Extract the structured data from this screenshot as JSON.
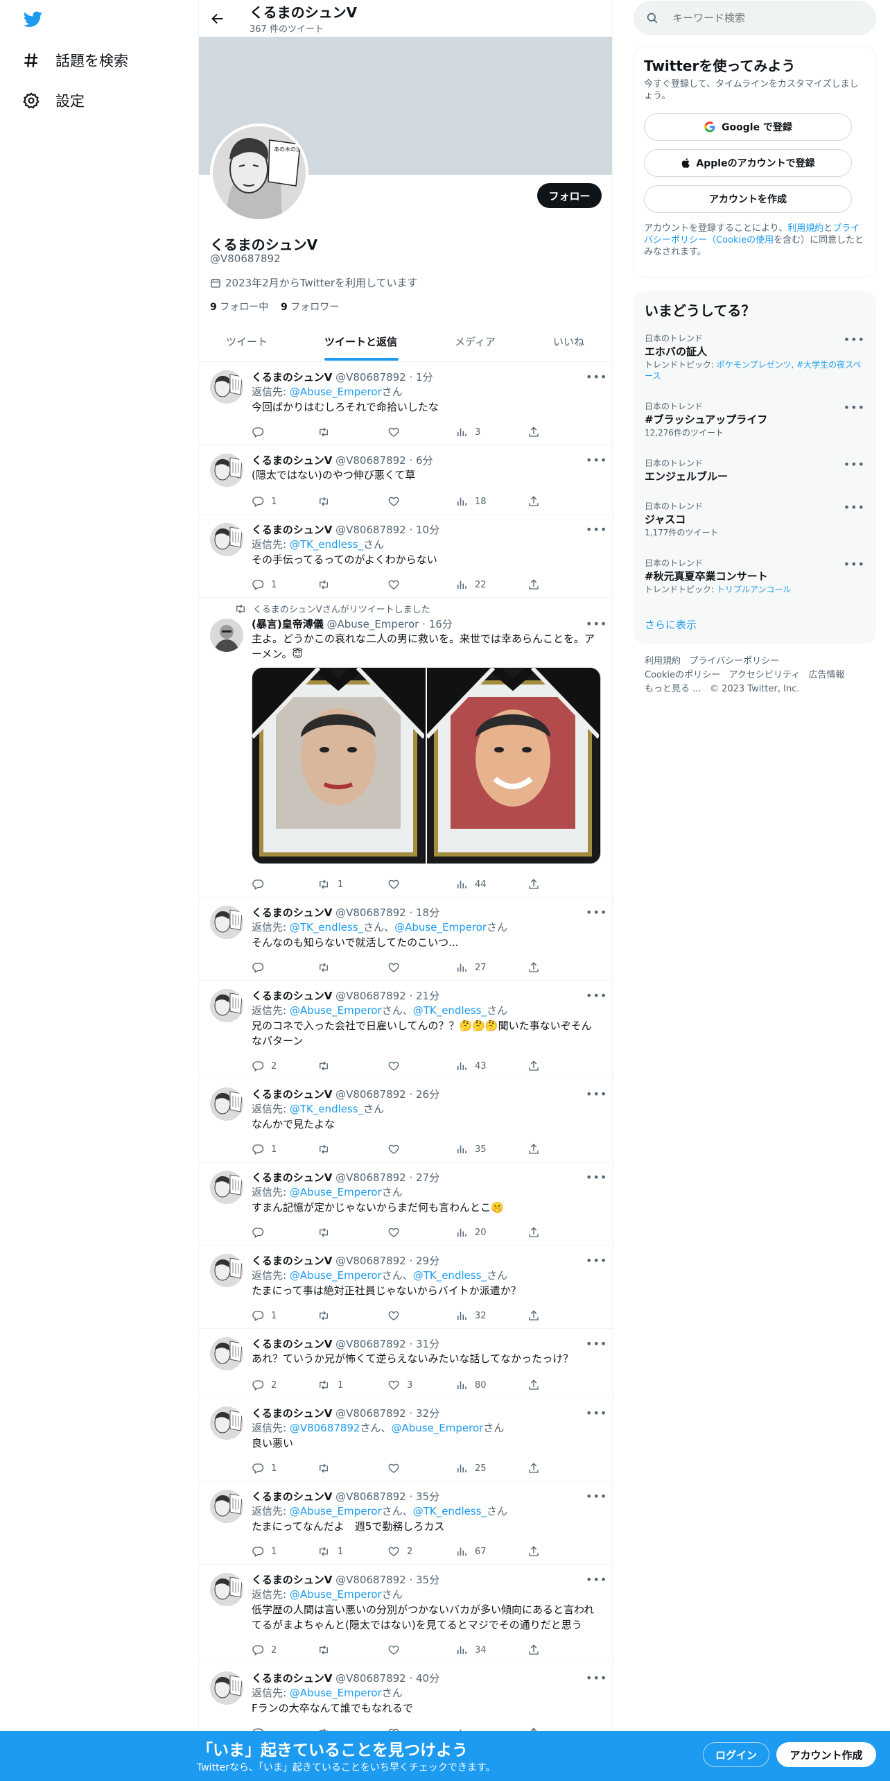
{
  "nav": {
    "explore": "話題を検索",
    "settings": "設定"
  },
  "header": {
    "name": "くるまのシュンV",
    "count": "367 件のツイート"
  },
  "profile": {
    "name": "くるまのシュンV",
    "handle": "@V80687892",
    "joined": "2023年2月からTwitterを利用しています",
    "following_num": "9",
    "following_label": "フォロー中",
    "followers_num": "9",
    "followers_label": "フォロワー",
    "follow_button": "フォロー",
    "avatar_text": "あの木の渋い実がる…"
  },
  "tabs": [
    "ツイート",
    "ツイートと返信",
    "メディア",
    "いいね"
  ],
  "tweets": [
    {
      "name": "くるまのシュンV",
      "handle": "@V80687892",
      "time": "1分",
      "reply_prefix": "返信先: ",
      "reply_to": "@Abuse_Emperor",
      "reply_suffix": "さん",
      "text": "今回ばかりはむしろそれで命拾いしたな",
      "replies": "",
      "retweets": "",
      "likes": "",
      "views": "3"
    },
    {
      "name": "くるまのシュンV",
      "handle": "@V80687892",
      "time": "6分",
      "text": "(隠太ではない)のやつ伸び悪くて草",
      "replies": "1",
      "retweets": "",
      "likes": "",
      "views": "18"
    },
    {
      "name": "くるまのシュンV",
      "handle": "@V80687892",
      "time": "10分",
      "reply_prefix": "返信先: ",
      "reply_to": "@TK_endless_",
      "reply_suffix": "さん",
      "text": "その手伝ってるってのがよくわからない",
      "replies": "1",
      "retweets": "",
      "likes": "",
      "views": "22"
    },
    {
      "retweet_label": "くるまのシュンVさんがリツイートしました",
      "name": "(暴言)皇帝溥儀",
      "handle": "@Abuse_Emperor",
      "time": "16分",
      "text": "主よ。どうかこの哀れな二人の男に救いを。来世では幸あらんことを。アーメン。😇",
      "replies": "",
      "retweets": "1",
      "likes": "",
      "views": "44"
    },
    {
      "name": "くるまのシュンV",
      "handle": "@V80687892",
      "time": "18分",
      "reply_prefix": "返信先: ",
      "reply_to": "@TK_endless_",
      "reply_suffix": "さん、",
      "reply_to2": "@Abuse_Emperor",
      "reply_suffix2": "さん",
      "text": "そんなのも知らないで就活してたのこいつ...",
      "replies": "",
      "retweets": "",
      "likes": "",
      "views": "27"
    },
    {
      "name": "くるまのシュンV",
      "handle": "@V80687892",
      "time": "21分",
      "reply_prefix": "返信先: ",
      "reply_to": "@Abuse_Emperor",
      "reply_suffix": "さん、",
      "reply_to2": "@TK_endless_",
      "reply_suffix2": "さん",
      "text": "兄のコネで入った会社で日雇いしてんの？？🤔🤔🤔聞いた事ないぞそんなパターン",
      "replies": "2",
      "retweets": "",
      "likes": "",
      "views": "43"
    },
    {
      "name": "くるまのシュンV",
      "handle": "@V80687892",
      "time": "26分",
      "reply_prefix": "返信先: ",
      "reply_to": "@TK_endless_",
      "reply_suffix": "さん",
      "text": "なんかで見たよな",
      "replies": "1",
      "retweets": "",
      "likes": "",
      "views": "35"
    },
    {
      "name": "くるまのシュンV",
      "handle": "@V80687892",
      "time": "27分",
      "reply_prefix": "返信先: ",
      "reply_to": "@Abuse_Emperor",
      "reply_suffix": "さん",
      "text": "すまん記憶が定かじゃないからまだ何も言わんとこ🤫",
      "replies": "",
      "retweets": "",
      "likes": "",
      "views": "20"
    },
    {
      "name": "くるまのシュンV",
      "handle": "@V80687892",
      "time": "29分",
      "reply_prefix": "返信先: ",
      "reply_to": "@Abuse_Emperor",
      "reply_suffix": "さん、",
      "reply_to2": "@TK_endless_",
      "reply_suffix2": "さん",
      "text": "たまにって事は絶対正社員じゃないからバイトか派遣か？",
      "replies": "1",
      "retweets": "",
      "likes": "",
      "views": "32"
    },
    {
      "name": "くるまのシュンV",
      "handle": "@V80687892",
      "time": "31分",
      "text": "あれ？ていうか兄が怖くて逆らえないみたいな話してなかったっけ？",
      "replies": "2",
      "retweets": "1",
      "likes": "3",
      "views": "80"
    },
    {
      "name": "くるまのシュンV",
      "handle": "@V80687892",
      "time": "32分",
      "reply_prefix": "返信先: ",
      "reply_to": "@V80687892",
      "reply_suffix": "さん、",
      "reply_to2": "@Abuse_Emperor",
      "reply_suffix2": "さん",
      "text": "良い悪い",
      "replies": "1",
      "retweets": "",
      "likes": "",
      "views": "25"
    },
    {
      "name": "くるまのシュンV",
      "handle": "@V80687892",
      "time": "35分",
      "reply_prefix": "返信先: ",
      "reply_to": "@Abuse_Emperor",
      "reply_suffix": "さん、",
      "reply_to2": "@TK_endless_",
      "reply_suffix2": "さん",
      "text": "たまにってなんだよ　週5で勤務しろカス",
      "replies": "1",
      "retweets": "1",
      "likes": "2",
      "views": "67"
    },
    {
      "name": "くるまのシュンV",
      "handle": "@V80687892",
      "time": "35分",
      "reply_prefix": "返信先: ",
      "reply_to": "@Abuse_Emperor",
      "reply_suffix": "さん",
      "text": "低学歴の人間は言い悪いの分別がつかないバカが多い傾向にあると言われてるがまよちゃんと(隠太ではない)を見てるとマジでその通りだと思う",
      "replies": "2",
      "retweets": "",
      "likes": "",
      "views": "34"
    },
    {
      "name": "くるまのシュンV",
      "handle": "@V80687892",
      "time": "40分",
      "reply_prefix": "返信先: ",
      "reply_to": "@Abuse_Emperor",
      "reply_suffix": "さん",
      "text": "Fランの大卒なんて誰でもなれるで",
      "replies": "",
      "retweets": "",
      "likes": "",
      "views": ""
    }
  ],
  "right": {
    "search_placeholder": "キーワード検索",
    "signup_title": "Twitterを使ってみよう",
    "signup_sub": "今すぐ登録して、タイムラインをカスタマイズしましょう。",
    "google": "Google で登録",
    "apple": "Appleのアカウントで登録",
    "create": "アカウントを作成",
    "terms_1": "アカウントを登録することにより、",
    "terms_link1": "利用規約",
    "terms_2": "と",
    "terms_link2": "プライバシーポリシー（Cookieの使用",
    "terms_3": "を含む）に同意したとみなされます。",
    "trends_title": "いまどうしてる？",
    "trends": [
      {
        "category": "日本のトレンド",
        "title": "エホバの証人",
        "sub_prefix": "トレンドトピック: ",
        "sub_links": "ポケモンプレゼンツ, #大学生の夜スペース"
      },
      {
        "category": "日本のトレンド",
        "title": "#ブラッシュアップライフ",
        "sub": "12,276件のツイート"
      },
      {
        "category": "日本のトレンド",
        "title": "エンジェルブルー"
      },
      {
        "category": "日本のトレンド",
        "title": "ジャスコ",
        "sub": "1,177件のツイート"
      },
      {
        "category": "日本のトレンド",
        "title": "#秋元真夏卒業コンサート",
        "sub_prefix": "トレンドトピック: ",
        "sub_links": "トリプルアンコール"
      }
    ],
    "show_more": "さらに表示",
    "footer": [
      "利用規約",
      "プライバシーポリシー",
      "Cookieのポリシー",
      "アクセシビリティ",
      "広告情報",
      "もっと見る ...",
      "© 2023 Twitter, Inc."
    ]
  },
  "bottom": {
    "title": "「いま」起きていることを見つけよう",
    "sub": "Twitterなら、「いま」起きていることをいち早くチェックできます。",
    "login": "ログイン",
    "signup": "アカウント作成"
  },
  "colors": {
    "accent": "#1d9bf0",
    "text": "#0f1419",
    "secondary": "#536471",
    "banner": "#cfd9de"
  }
}
